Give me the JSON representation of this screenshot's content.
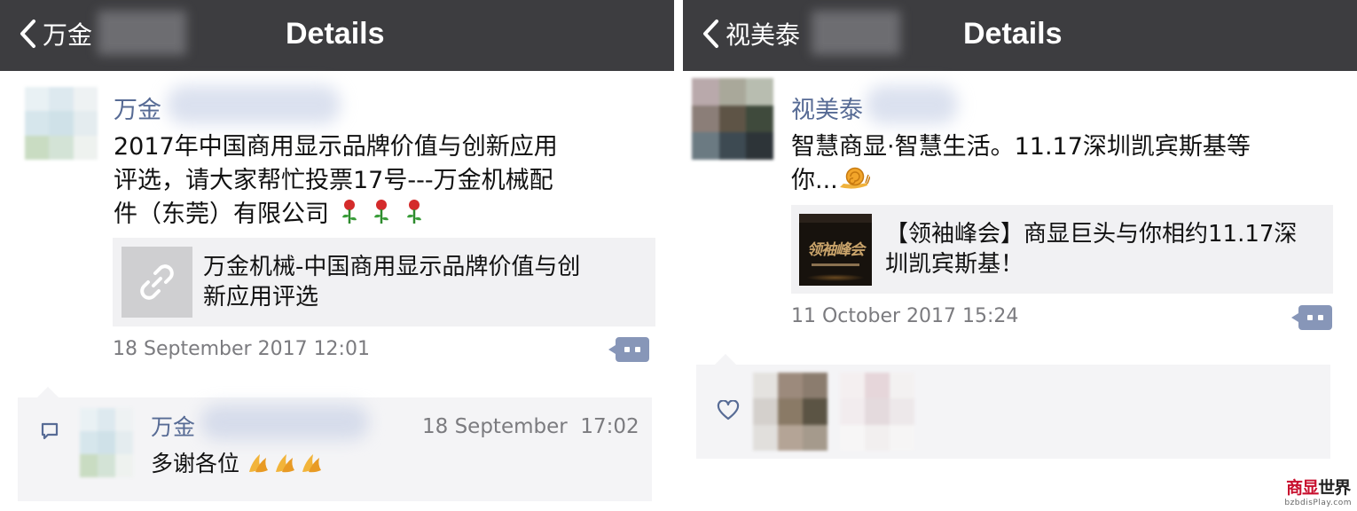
{
  "left": {
    "nav": {
      "back_label": "万金",
      "title": "Details"
    },
    "post": {
      "author": "万金",
      "text_lines": [
        "2017年中国商用显示品牌价值与创新应用",
        "评选，请大家帮忙投票17号---万金机械配",
        "件（东莞）有限公司"
      ],
      "link": {
        "title_lines": [
          "万金机械-中国商用显示品牌价值与创",
          "新应用评选"
        ]
      },
      "time": "18 September 2017 12:01"
    },
    "comment": {
      "author": "万金",
      "date": "18 September",
      "time": "17:02",
      "text": "多谢各位"
    }
  },
  "right": {
    "nav": {
      "back_label": "视美泰",
      "title": "Details"
    },
    "post": {
      "author": "视美泰",
      "text_lines": [
        "智慧商显·智慧生活。11.17深圳凯宾斯基等",
        "你..."
      ],
      "link": {
        "title_lines": [
          "【领袖峰会】商显巨头与你相约11.17深",
          "圳凯宾斯基！"
        ],
        "thumb_text": "领袖峰会"
      },
      "time": "11 October 2017 15:24"
    }
  },
  "watermark": {
    "top_red": "商显",
    "top_black": "世界",
    "bottom": "bzbdisPlay.com"
  },
  "colors": {
    "nav_bg": "#3d3d40",
    "name_link": "#576b95",
    "card_bg": "#f1f1f3",
    "time": "#7b7b7f",
    "comment_btn": "#8796b8"
  }
}
